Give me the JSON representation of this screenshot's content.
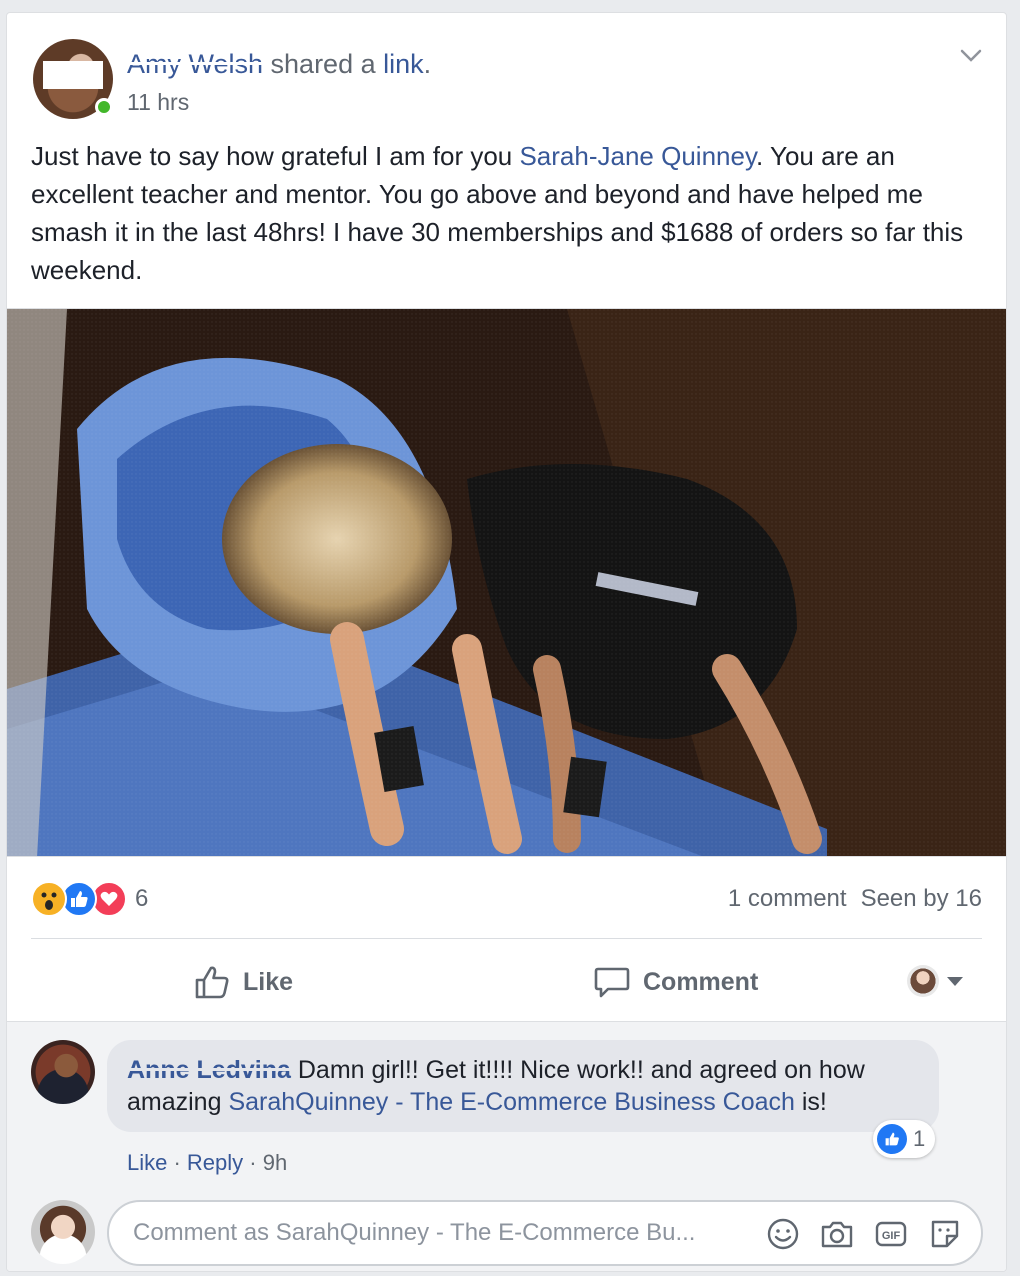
{
  "post": {
    "author": "Amy Welsh",
    "action_text": " shared a ",
    "action_link": "link",
    "action_end": ".",
    "timestamp": "11 hrs",
    "text_before": "Just have to say how grateful I am for you ",
    "mention": "Sarah-Jane Quinney",
    "text_after": ". You are an excellent teacher and mentor. You go above and beyond and have helped me smash it in the last 48hrs! I have 30 memberships and $1688 of orders so far this weekend."
  },
  "reactions": {
    "icons": [
      "wow-icon",
      "like-icon",
      "love-icon"
    ],
    "count": "6",
    "comments": "1 comment",
    "seen": "Seen by 16"
  },
  "actions": {
    "like_label": "Like",
    "comment_label": "Comment"
  },
  "comment": {
    "author": "Anne Ledvina",
    "text_before": "Damn girl!! Get it!!!! Nice work!! and agreed on how amazing ",
    "mention": "SarahQuinney - The E-Commerce Business Coach",
    "text_after": " is!",
    "like_count": "1",
    "like_label": "Like",
    "reply_label": "Reply",
    "separator": " · ",
    "time": "9h"
  },
  "composer": {
    "placeholder": "Comment as SarahQuinney - The E-Commerce Bu..."
  },
  "colors": {
    "link": "#385898",
    "like_blue": "#2078f4",
    "love_red": "#f33e58",
    "wow_yellow": "#f7b125",
    "online_green": "#42b72a"
  }
}
